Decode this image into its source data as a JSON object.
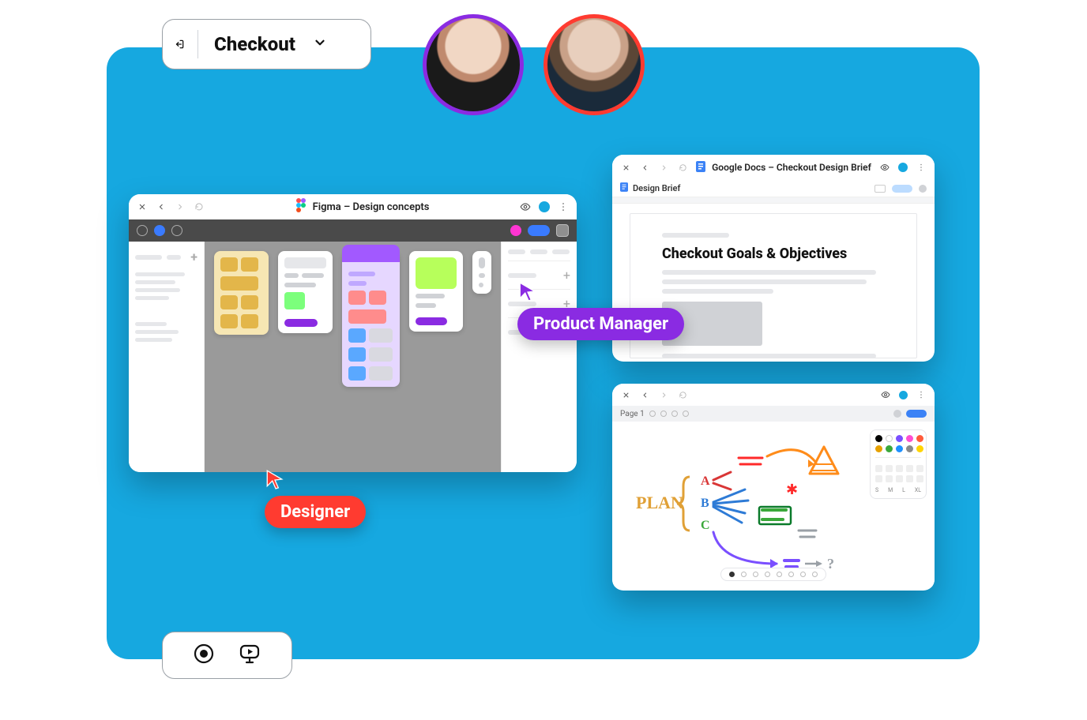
{
  "header": {
    "title": "Checkout"
  },
  "avatars": [
    "participant-1",
    "participant-2"
  ],
  "cursors": {
    "designer": "Designer",
    "pm": "Product Manager"
  },
  "figma": {
    "title": "Figma – Design concepts"
  },
  "docs": {
    "app_title": "Google Docs – Checkout Design Brief",
    "tab_label": "Design Brief",
    "heading": "Checkout Goals & Objectives"
  },
  "whiteboard": {
    "page_label": "Page 1",
    "plan_text": "PLAN",
    "options": [
      "A",
      "B",
      "C"
    ],
    "palette_sizes": [
      "S",
      "M",
      "L",
      "XL"
    ],
    "palette_colors": [
      "#000000",
      "#ffffff",
      "#7a4fff",
      "#ff4fd1",
      "#ff5b3a",
      "#e6a100",
      "#3aa83a",
      "#1e90ff",
      "#8a8a8a",
      "#ffd400"
    ]
  }
}
